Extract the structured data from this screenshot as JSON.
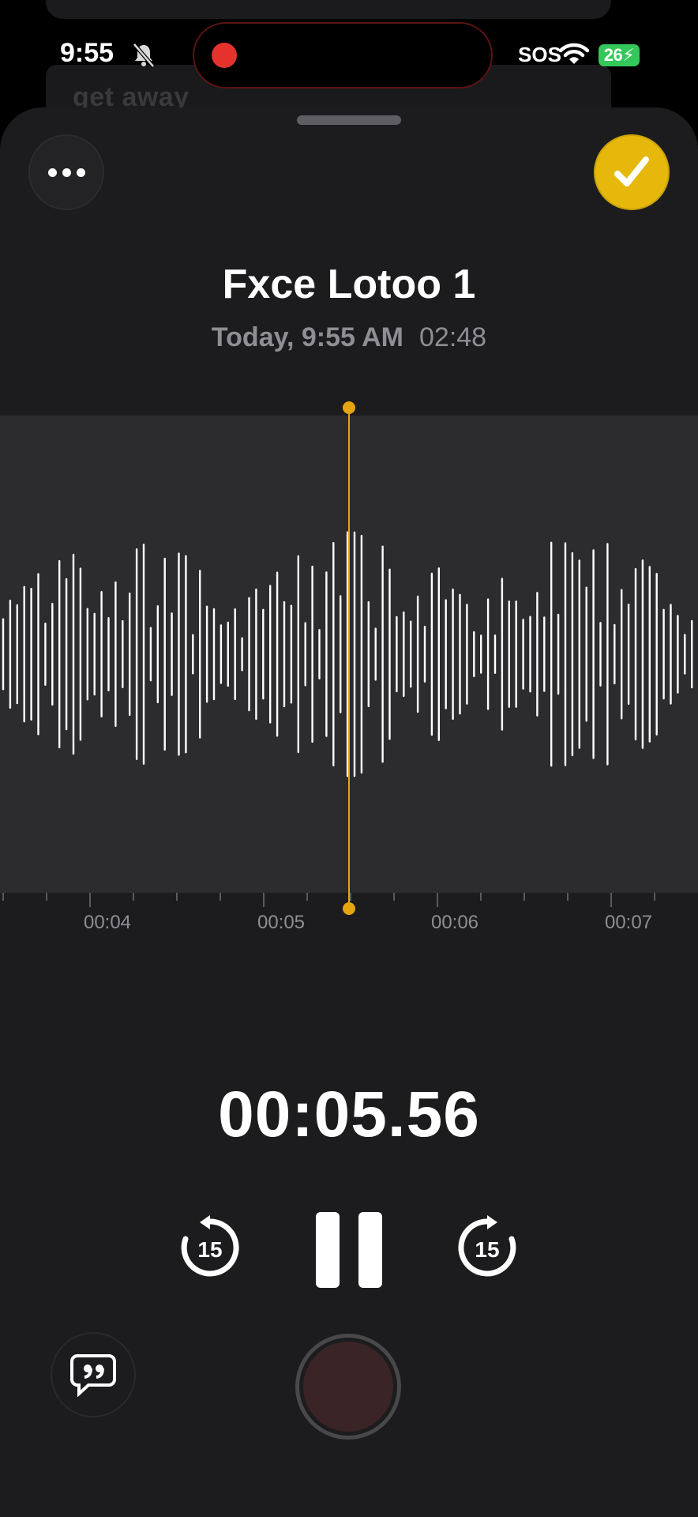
{
  "background": {
    "text": "get away"
  },
  "status_bar": {
    "time": "9:55",
    "sos": "SOS",
    "battery": "26"
  },
  "recording": {
    "title": "Fxce Lotoo 1",
    "date": "Today, 9:55 AM",
    "duration": "02:48",
    "current_time": "00:05.56",
    "skip_back_seconds": "15",
    "skip_forward_seconds": "15"
  },
  "timeline": {
    "labels": [
      "00:04",
      "00:05",
      "00:06",
      "00:07"
    ]
  },
  "colors": {
    "accent": "#e5a50f",
    "done_button": "#e5b80b",
    "record": "#3a2426",
    "sheet": "#1c1c1e",
    "wave_bg": "#2c2c2e"
  },
  "icons": [
    "bell-slash-icon",
    "wifi-icon",
    "more-icon",
    "checkmark-icon",
    "skip-back-15-icon",
    "pause-icon",
    "skip-forward-15-icon",
    "transcript-icon",
    "record-icon"
  ]
}
